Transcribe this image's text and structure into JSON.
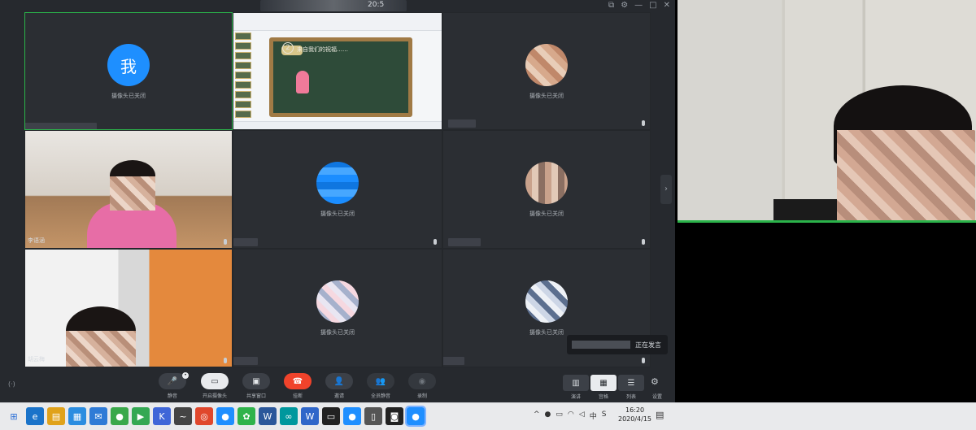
{
  "window": {
    "title_suffix": "20:5",
    "controls": [
      "⧉",
      "⚙",
      "—",
      "□",
      "✕"
    ]
  },
  "tiles": [
    {
      "id": "me",
      "avatar_text": "我",
      "status": "摄像头已关闭",
      "active": true
    },
    {
      "id": "screen-share",
      "slide": {
        "caption": "",
        "heading": "来自我们的祝福……",
        "number": "2"
      }
    },
    {
      "id": "p3",
      "status": "摄像头已关闭"
    },
    {
      "id": "p4",
      "name": "李语涵"
    },
    {
      "id": "p5",
      "status": "摄像头已关闭"
    },
    {
      "id": "p6",
      "status": "摄像头已关闭"
    },
    {
      "id": "p7",
      "name": "胡云梅"
    },
    {
      "id": "p8",
      "status": "摄像头已关闭"
    },
    {
      "id": "p9",
      "status": "摄像头已关闭"
    }
  ],
  "speaker_badge": {
    "text": "正在发言"
  },
  "toolbar": {
    "left_label": "(·)",
    "buttons": [
      {
        "label": "静音",
        "icon": "🎤"
      },
      {
        "label": "开启摄像头",
        "icon": "▭"
      },
      {
        "label": "共享窗口",
        "icon": "▣"
      },
      {
        "label": "挂断",
        "icon": "☎"
      },
      {
        "label": "邀请",
        "icon": "👤"
      },
      {
        "label": "全员静音",
        "icon": "👥"
      },
      {
        "label": "录制",
        "icon": "◉"
      }
    ],
    "views": [
      {
        "label": "演讲",
        "icon": "▥"
      },
      {
        "label": "宫格",
        "icon": "▦"
      },
      {
        "label": "列表",
        "icon": "☰"
      }
    ],
    "settings_label": "设置"
  },
  "taskbar": {
    "clock_time": "16:20",
    "clock_date": "2020/4/15",
    "ime": "中",
    "icons": [
      {
        "glyph": "⊞",
        "color": "#2b6fd6"
      },
      {
        "glyph": "e",
        "color": "#1a73c9"
      },
      {
        "glyph": "▤",
        "color": "#e0a21a"
      },
      {
        "glyph": "▦",
        "color": "#2b8de0"
      },
      {
        "glyph": "✉",
        "color": "#2f7bd6"
      },
      {
        "glyph": "●",
        "color": "#3aa84a"
      },
      {
        "glyph": "▶",
        "color": "#34a853"
      },
      {
        "glyph": "K",
        "color": "#3f66d8"
      },
      {
        "glyph": "~",
        "color": "#444"
      },
      {
        "glyph": "◎",
        "color": "#e0472c"
      },
      {
        "glyph": "●",
        "color": "#1f8fff"
      },
      {
        "glyph": "✿",
        "color": "#2fb34a"
      },
      {
        "glyph": "W",
        "color": "#2b579a"
      },
      {
        "glyph": "∞",
        "color": "#00979d"
      },
      {
        "glyph": "W",
        "color": "#2f66c9"
      },
      {
        "glyph": "▭",
        "color": "#222"
      },
      {
        "glyph": "●",
        "color": "#1f8fff"
      },
      {
        "glyph": "▯",
        "color": "#555"
      },
      {
        "glyph": "◙",
        "color": "#222"
      },
      {
        "glyph": "●",
        "color": "#1f8fff"
      }
    ]
  }
}
